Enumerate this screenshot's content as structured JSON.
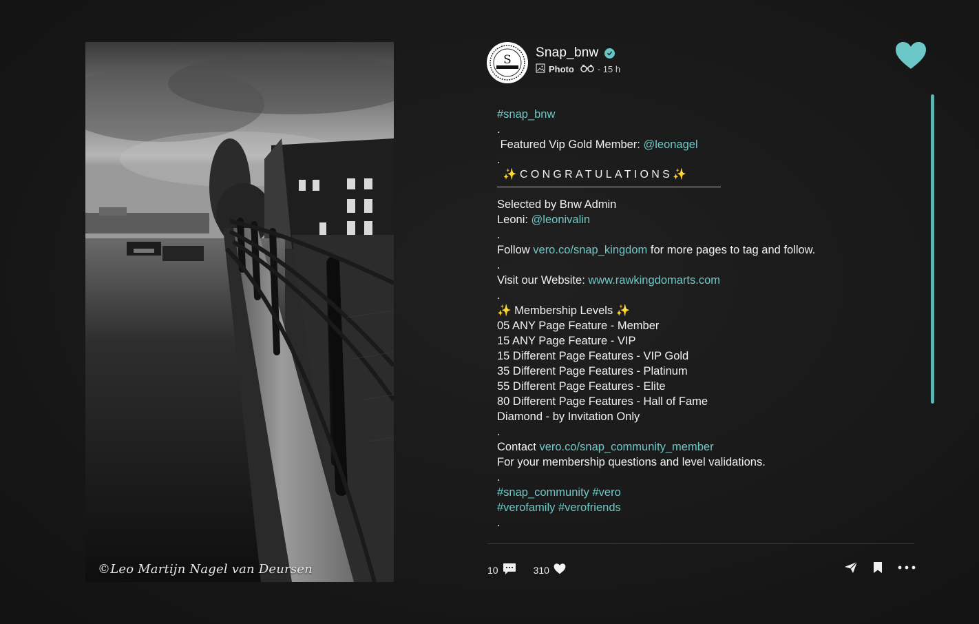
{
  "post": {
    "username": "Snap_bnw",
    "post_type": "Photo",
    "time_ago": "- 15 h",
    "avatar_text": "S",
    "photo_watermark": "©Leo Martijn Nagel van Deursen"
  },
  "caption": {
    "hashtag_top": "#snap_bnw",
    "dot": ".",
    "featured_label": "Featured Vip Gold Member: ",
    "featured_handle": "@leonagel",
    "congrats": "✨CONGRATULATIONS✨",
    "selected_by": "Selected by Bnw Admin",
    "leoni_label": "Leoni: ",
    "leoni_handle": "@leonivalin",
    "follow_prefix": "Follow ",
    "follow_link": "vero.co/snap_kingdom",
    "follow_suffix": " for more pages to tag and follow.",
    "visit_prefix": "Visit our Website:  ",
    "visit_link": "www.rawkingdomarts.com",
    "membership_title": "✨ Membership Levels ✨",
    "levels": [
      "05 ANY Page Feature - Member",
      "15 ANY Page Feature - VIP",
      "15 Different Page Features - VIP Gold",
      "35 Different Page Features - Platinum",
      "55 Different Page Features - Elite",
      "80 Different Page Features - Hall of Fame",
      "Diamond - by Invitation Only"
    ],
    "contact_prefix": "Contact ",
    "contact_link": "vero.co/snap_community_member",
    "contact_note": "For your membership questions and level validations.",
    "hashtags_1": "#snap_community #vero",
    "hashtags_2": "#verofamily #verofriends"
  },
  "actions": {
    "comments_count": "10",
    "likes_count": "310"
  },
  "colors": {
    "accent": "#6ec9c6",
    "background": "#161616"
  },
  "icons": [
    "verified-icon",
    "photo-icon",
    "binoculars-icon",
    "love-icon",
    "comment-icon",
    "heart-icon",
    "share-icon",
    "bookmark-icon",
    "more-icon"
  ]
}
